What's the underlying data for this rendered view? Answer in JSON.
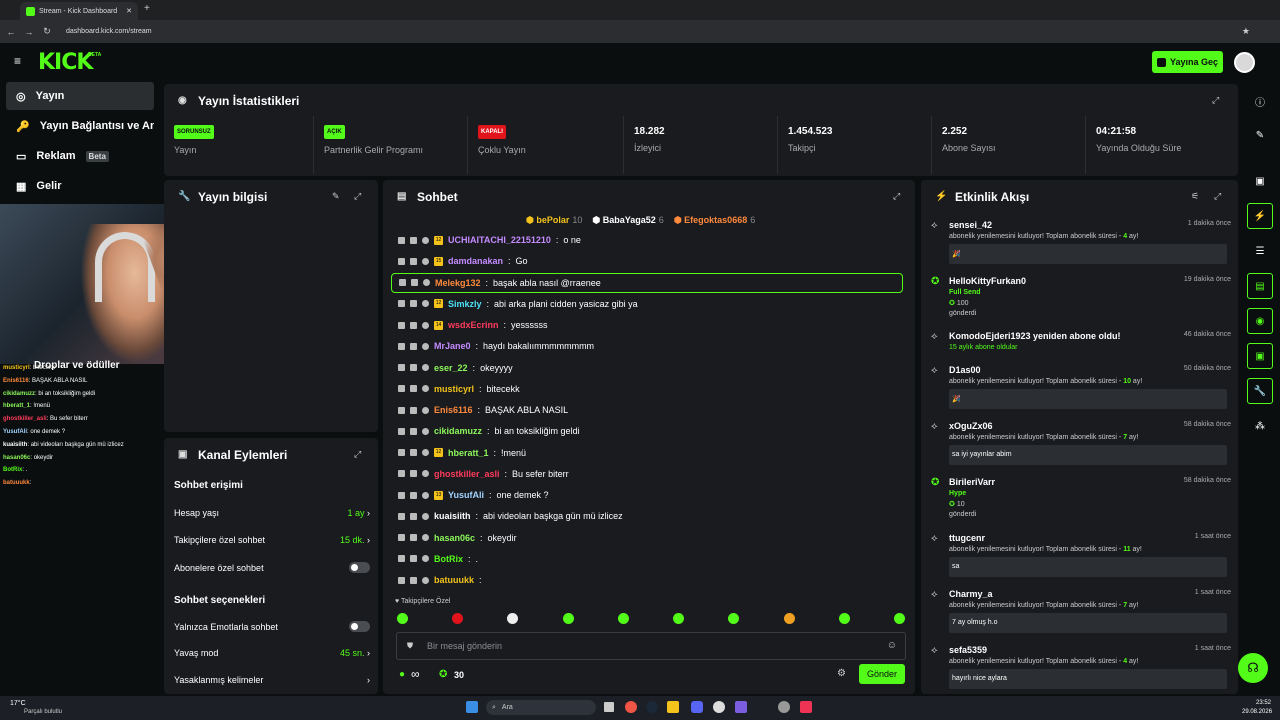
{
  "browser": {
    "tab_title": "Stream - Kick Dashboard",
    "url": "dashboard.kick.com/stream"
  },
  "header": {
    "logo": "KICK",
    "logo_badge": "BETA",
    "go_live": "Yayına Geç"
  },
  "sidebar": {
    "items": [
      {
        "label": "Yayın",
        "icon": "broadcast-icon"
      },
      {
        "label": "Yayın Bağlantısı ve Anahtarı",
        "icon": "key-icon"
      },
      {
        "label": "Reklam",
        "badge": "Beta",
        "icon": "ad-icon"
      },
      {
        "label": "Gelir",
        "icon": "revenue-icon"
      }
    ],
    "drops_label": "Droplar ve ödüller"
  },
  "mini_chat": [
    {
      "user": "musticyrl",
      "text": "bitecekk",
      "color": "#f3c21b"
    },
    {
      "user": "Enis6116",
      "text": "BAŞAK ABLA NASIL",
      "color": "#ff8a3d"
    },
    {
      "user": "cikidamuzz",
      "text": "bi an toksikliğim geldi",
      "color": "#8cf65a"
    },
    {
      "user": "hberatt_1",
      "text": "!menü",
      "color": "#8cf65a"
    },
    {
      "user": "ghostkiller_asli",
      "text": "Bu sefer biterr",
      "color": "#ff3b5c"
    },
    {
      "user": "YusufAli",
      "text": "one demek ?",
      "color": "#a3d4ff"
    },
    {
      "user": "kuaisiith",
      "text": "abi videoları başkga gün mü izlicez",
      "color": "#fff"
    },
    {
      "user": "hasan06c",
      "text": "okeydir",
      "color": "#8cf65a"
    },
    {
      "user": "BotRix",
      "text": ".",
      "color": "#53fc18"
    },
    {
      "user": "batuuukk",
      "text": "",
      "color": "#ff8a3d"
    }
  ],
  "stats": {
    "title": "Yayın İstatistikleri",
    "items": [
      {
        "badge": "SORUNSUZ",
        "badge_color": "#53fc18",
        "label": "Yayın"
      },
      {
        "badge": "AÇIK",
        "badge_color": "#53fc18",
        "label": "Partnerlik Gelir Programı"
      },
      {
        "badge": "KAPALI",
        "badge_color": "#e1141c",
        "label": "Çoklu Yayın"
      },
      {
        "value": "18.282",
        "label": "İzleyici"
      },
      {
        "value": "1.454.523",
        "label": "Takipçi"
      },
      {
        "value": "2.252",
        "label": "Abone Sayısı"
      },
      {
        "value": "04:21:58",
        "label": "Yayında Olduğu Süre"
      }
    ]
  },
  "stream_info": {
    "title": "Yayın bilgisi"
  },
  "chat": {
    "title": "Sohbet",
    "top_gifters": [
      {
        "name": "bePolar",
        "count": "10",
        "color": "#f3c21b"
      },
      {
        "name": "BabaYaga52",
        "count": "6",
        "color": "#ffffff"
      },
      {
        "name": "Efegoktas0668",
        "count": "6",
        "color": "#ff8a3d"
      }
    ],
    "messages": [
      {
        "user": "UCHIAITACHI_22151210",
        "text": "o ne",
        "color": "#c58cff",
        "badge": "12",
        "highlight": false
      },
      {
        "user": "damdanakan",
        "text": "Go",
        "color": "#c58cff",
        "badge": "15",
        "highlight": false
      },
      {
        "user": "Melekg132",
        "text": "başak abla nasıl @rraenee",
        "color": "#ff8a3d",
        "badge": "",
        "highlight": true
      },
      {
        "user": "Simkzly",
        "text": "abi arka plani cidden yasicaz gibi ya",
        "color": "#4de1f5",
        "badge": "12",
        "highlight": false
      },
      {
        "user": "wsdxEcrinn",
        "text": "yessssss",
        "color": "#ff3b5c",
        "badge": "14",
        "highlight": false
      },
      {
        "user": "MrJane0",
        "text": "haydı bakalıımmmmmmmm",
        "color": "#c58cff",
        "badge": "",
        "highlight": false
      },
      {
        "user": "eser_22",
        "text": "okeyyyy",
        "color": "#8cf65a",
        "badge": "",
        "highlight": false
      },
      {
        "user": "musticyrl",
        "text": "bitecekk",
        "color": "#f3c21b",
        "badge": "",
        "highlight": false
      },
      {
        "user": "Enis6116",
        "text": "BAŞAK ABLA NASIL",
        "color": "#ff8a3d",
        "badge": "",
        "highlight": false
      },
      {
        "user": "cikidamuzz",
        "text": "bi an toksikliğim geldi",
        "color": "#8cf65a",
        "badge": "",
        "highlight": false
      },
      {
        "user": "hberatt_1",
        "text": "!menü",
        "color": "#8cf65a",
        "badge": "12",
        "highlight": false
      },
      {
        "user": "ghostkiller_asli",
        "text": "Bu sefer biterr",
        "color": "#ff3b5c",
        "badge": "",
        "highlight": false
      },
      {
        "user": "YusufAli",
        "text": "one demek ?",
        "color": "#a3d4ff",
        "badge": "13",
        "highlight": false
      },
      {
        "user": "kuaisiith",
        "text": "abi videoları başkga gün mü izlicez",
        "color": "#ffffff",
        "badge": "",
        "highlight": false
      },
      {
        "user": "hasan06c",
        "text": "okeydir",
        "color": "#8cf65a",
        "badge": "",
        "highlight": false
      },
      {
        "user": "BotRix",
        "text": ".",
        "color": "#53fc18",
        "badge": "",
        "highlight": false
      },
      {
        "user": "batuuukk",
        "text": "",
        "color": "#f3c21b",
        "badge": "",
        "highlight": false
      }
    ],
    "followers_only_label": "Takipçilere Özel",
    "input_placeholder": "Bir mesaj gönderin",
    "infinite_label": "∞",
    "points": "30",
    "send_label": "Gönder"
  },
  "channel_actions": {
    "title": "Kanal Eylemleri",
    "chat_access": "Sohbet erişimi",
    "account_age_label": "Hesap yaşı",
    "account_age_value": "1 ay",
    "followers_only_label": "Takipçilere özel sohbet",
    "followers_only_value": "15 dk.",
    "subs_only_label": "Abonelere özel sohbet",
    "chat_options": "Sohbet seçenekleri",
    "emote_only_label": "Yalnızca Emotlarla sohbet",
    "slow_mode_label": "Yavaş mod",
    "slow_mode_value": "45 sn.",
    "banned_words_label": "Yasaklanmış kelimeler"
  },
  "activity": {
    "title": "Etkinlik Akışı",
    "items": [
      {
        "name": "sensei_42",
        "time": "1 dakika önce",
        "desc": "abonelik yenilemesini kutluyor! Toplam abonelik süresi - ",
        "months": "4",
        "unit": " ay!",
        "box": "🎉"
      },
      {
        "name": "HelloKittyFurkan0",
        "time": "19 dakika önce",
        "desc": "Full Send",
        "amount": "100",
        "sent": "gönderdi"
      },
      {
        "name": "KomodoEjderi1923 yeniden abone oldu!",
        "time": "46 dakika önce",
        "desc": "15 aylık abone oldular"
      },
      {
        "name": "D1as00",
        "time": "50 dakika önce",
        "desc": "abonelik yenilemesini kutluyor! Toplam abonelik süresi - ",
        "months": "10",
        "unit": " ay!",
        "box": "🎉"
      },
      {
        "name": "xOguZx06",
        "time": "58 dakika önce",
        "desc": "abonelik yenilemesini kutluyor! Toplam abonelik süresi - ",
        "months": "7",
        "unit": " ay!",
        "box": "sa iyi yayınlar abim"
      },
      {
        "name": "BirileriVarr",
        "time": "58 dakika önce",
        "desc": "Hype",
        "amount": "10",
        "sent": "gönderdi"
      },
      {
        "name": "ttugcenr",
        "time": "1 saat önce",
        "desc": "abonelik yenilemesini kutluyor! Toplam abonelik süresi - ",
        "months": "11",
        "unit": " ay!",
        "box": "sa"
      },
      {
        "name": "Charmy_a",
        "time": "1 saat önce",
        "desc": "abonelik yenilemesini kutluyor! Toplam abonelik süresi - ",
        "months": "7",
        "unit": " ay!",
        "box": "7 ay olmuş h.o"
      },
      {
        "name": "sefa5359",
        "time": "1 saat önce",
        "desc": "abonelik yenilemesini kutluyor! Toplam abonelik süresi - ",
        "months": "4",
        "unit": " ay!",
        "box": "hayırlı nice aylara"
      }
    ]
  },
  "taskbar": {
    "weather_temp": "17°C",
    "weather_desc": "Parçalı bulutlu",
    "search": "Ara",
    "time": "23:52",
    "date": "29.08.2026"
  }
}
